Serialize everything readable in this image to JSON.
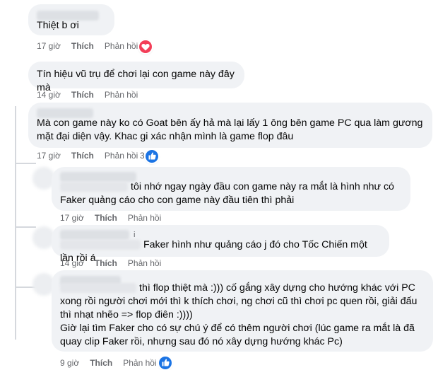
{
  "comments": [
    {
      "text": "Thiệt b ơi",
      "meta": {
        "time": "17 giờ",
        "like": "Thích",
        "reply": "Phản hồi"
      },
      "reaction": "heart-icon"
    },
    {
      "text": "Tín hiệu vũ trụ để chơi lại con game này đây mà",
      "meta": {
        "time": "14 giờ",
        "like": "Thích",
        "reply": "Phản hồi"
      }
    },
    {
      "text_lines": [
        "Mà con game này ko có Goat bên ấy hả mà lại lấy 1 ông bên game PC qua làm gương",
        "mặt đại diện vậy. Khac gi xác nhận mình là game flop đâu"
      ],
      "meta": {
        "time": "17 giờ",
        "like": "Thích",
        "reply": "Phản hồi"
      },
      "reaction_count": "3",
      "reaction": "like-icon"
    }
  ],
  "replies": [
    {
      "text_lines": [
        "tôi nhớ ngay ngày đầu con game này ra mắt là hình như có",
        "Faker quảng cáo cho con game này đầu tiên thì phải"
      ],
      "meta": {
        "time": "17 giờ",
        "like": "Thích",
        "reply": "Phản hồi"
      }
    },
    {
      "name_fragment": "i",
      "text": "Faker hình như quảng cáo j đó cho Tốc Chiến một lần rồi á",
      "meta": {
        "time": "14 giờ",
        "like": "Thích",
        "reply": "Phản hồi"
      }
    },
    {
      "text_lines": [
        "thì flop thiệt mà :))) cố gắng xây dựng cho hướng khác với PC",
        "xong rồi người chơi mới thì k thích chơi, ng chơi cũ thì chơi pc quen rồi, giải đấu",
        "thì nhạt nhẽo => flop điên :))))",
        "Giờ lại tìm Faker cho có sự chú ý để có thêm người chơi (lúc game ra mắt là đã",
        "quay clip Faker rồi, nhưng sau đó nó xây dựng hướng khác Pc)"
      ],
      "meta": {
        "time": "9 giờ",
        "like": "Thích",
        "reply": "Phản hồi"
      },
      "reaction": "like-icon"
    }
  ],
  "colors": {
    "bubble": "#f0f2f5",
    "meta_text": "#65676b",
    "heart": "#f33e58",
    "like": "#1b74e4",
    "thread_line": "#d5d8dd"
  }
}
